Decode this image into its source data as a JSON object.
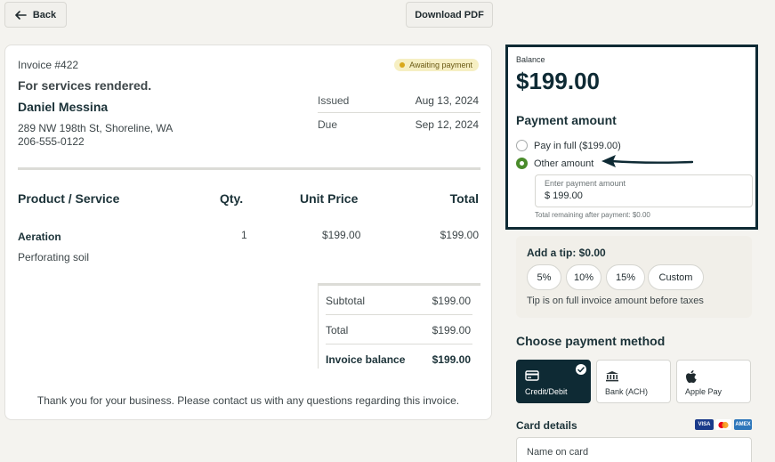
{
  "toolbar": {
    "back_label": "Back",
    "download_label": "Download PDF"
  },
  "invoice": {
    "number": "Invoice #422",
    "status": "Awaiting payment",
    "subtitle": "For services rendered.",
    "client_name": "Daniel Messina",
    "address": "289 NW 198th St, Shoreline, WA",
    "phone": "206-555-0122",
    "issued_label": "Issued",
    "issued_date": "Aug 13, 2024",
    "due_label": "Due",
    "due_date": "Sep 12, 2024",
    "columns": {
      "product": "Product / Service",
      "qty": "Qty.",
      "unit_price": "Unit Price",
      "total": "Total"
    },
    "items": [
      {
        "name": "Aeration",
        "description": "Perforating soil",
        "qty": "1",
        "unit_price": "$199.00",
        "total": "$199.00"
      }
    ],
    "subtotal_label": "Subtotal",
    "subtotal": "$199.00",
    "total_label": "Total",
    "total": "$199.00",
    "balance_label": "Invoice balance",
    "balance": "$199.00",
    "thanks": "Thank you for your business. Please contact us with any questions regarding this invoice."
  },
  "payment": {
    "balance_label": "Balance",
    "balance": "$199.00",
    "heading": "Payment amount",
    "option_full": "Pay in full ($199.00)",
    "option_other": "Other amount",
    "selected_option": "other",
    "amount_label": "Enter payment amount",
    "amount_value": "$ 199.00",
    "remaining": "Total remaining after payment: $0.00"
  },
  "tip": {
    "heading": "Add a tip: $0.00",
    "options": [
      "5%",
      "10%",
      "15%",
      "Custom"
    ],
    "note": "Tip is on full invoice amount before taxes"
  },
  "methods": {
    "heading": "Choose payment method",
    "items": [
      {
        "label": "Credit/Debit",
        "icon": "credit-card-icon",
        "selected": true
      },
      {
        "label": "Bank (ACH)",
        "icon": "bank-icon",
        "selected": false
      },
      {
        "label": "Apple Pay",
        "icon": "apple-icon",
        "selected": false
      }
    ]
  },
  "card": {
    "heading": "Card details",
    "brands": [
      "VISA",
      "Mastercard",
      "AMEX"
    ],
    "visa_text": "VISA",
    "amex_text": "AMEX",
    "name_placeholder": "Name on card"
  },
  "colors": {
    "accent": "#0e2a34",
    "radio_on": "#4a8b2b",
    "badge_bg": "#f6efc3",
    "page_bg": "#f4f3ef"
  }
}
